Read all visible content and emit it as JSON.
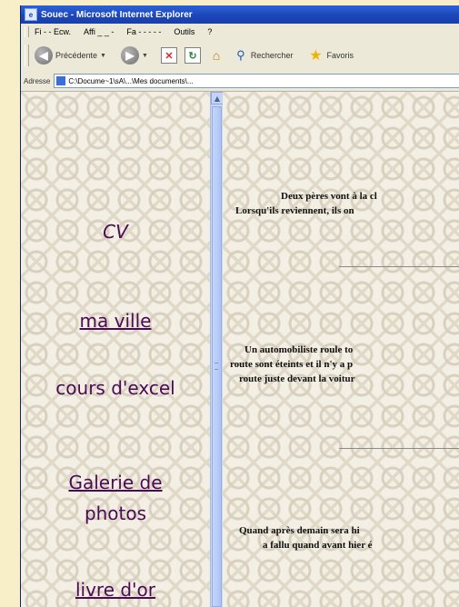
{
  "window": {
    "title": "Souec - Microsoft Internet Explorer",
    "app_icon": "ie-icon"
  },
  "menubar": {
    "items": [
      "Fi  - - Ecw.",
      "Affi  _ _ -",
      "Fa - - - - -",
      "Outils",
      "?"
    ]
  },
  "toolbar": {
    "back_label": "Précédente",
    "search_label": "Rechercher",
    "favorites_label": "Favoris"
  },
  "address": {
    "label": "Adresse",
    "value": "C:\\Docume~1\\sA\\...\\Mes documents\\..."
  },
  "nav": {
    "cv": "CV",
    "ville": "ma ville",
    "excel": "cours d'excel",
    "galerie_1": "Galerie de",
    "galerie_2": "photos",
    "livre": "livre d'or"
  },
  "stories": [
    {
      "line1": "Deux pères vont à la cl",
      "line2": "Lorsqu'ils reviennent, ils on"
    },
    {
      "line1": "Un automobiliste roule to",
      "line2": "route sont éteints et il n'y a p",
      "line3": "route juste devant la voitur"
    },
    {
      "line1": "Quand après demain sera hi",
      "line2": "a fallu quand avant hier é"
    }
  ]
}
